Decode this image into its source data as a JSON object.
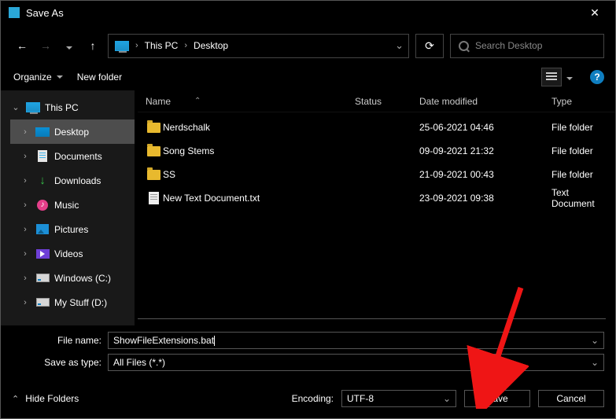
{
  "window": {
    "title": "Save As"
  },
  "breadcrumb": {
    "root": "This PC",
    "current": "Desktop"
  },
  "search": {
    "placeholder": "Search Desktop"
  },
  "toolbar": {
    "organize": "Organize",
    "newfolder": "New folder"
  },
  "sidebar": {
    "root": "This PC",
    "items": [
      {
        "label": "Desktop"
      },
      {
        "label": "Documents"
      },
      {
        "label": "Downloads"
      },
      {
        "label": "Music"
      },
      {
        "label": "Pictures"
      },
      {
        "label": "Videos"
      },
      {
        "label": "Windows (C:)"
      },
      {
        "label": "My Stuff (D:)"
      }
    ]
  },
  "columns": {
    "name": "Name",
    "status": "Status",
    "date": "Date modified",
    "type": "Type"
  },
  "files": [
    {
      "name": "Nerdschalk",
      "date": "25-06-2021 04:46",
      "type": "File folder",
      "kind": "folder"
    },
    {
      "name": "Song Stems",
      "date": "09-09-2021 21:32",
      "type": "File folder",
      "kind": "folder"
    },
    {
      "name": "SS",
      "date": "21-09-2021 00:43",
      "type": "File folder",
      "kind": "folder"
    },
    {
      "name": "New Text Document.txt",
      "date": "23-09-2021 09:38",
      "type": "Text Document",
      "kind": "txt"
    }
  ],
  "fields": {
    "filename_label": "File name:",
    "filename_value": "ShowFileExtensions.bat",
    "saveas_label": "Save as type:",
    "saveas_value": "All Files  (*.*)"
  },
  "footer": {
    "hide": "Hide Folders",
    "encoding_label": "Encoding:",
    "encoding_value": "UTF-8",
    "save": "Save",
    "cancel": "Cancel"
  }
}
